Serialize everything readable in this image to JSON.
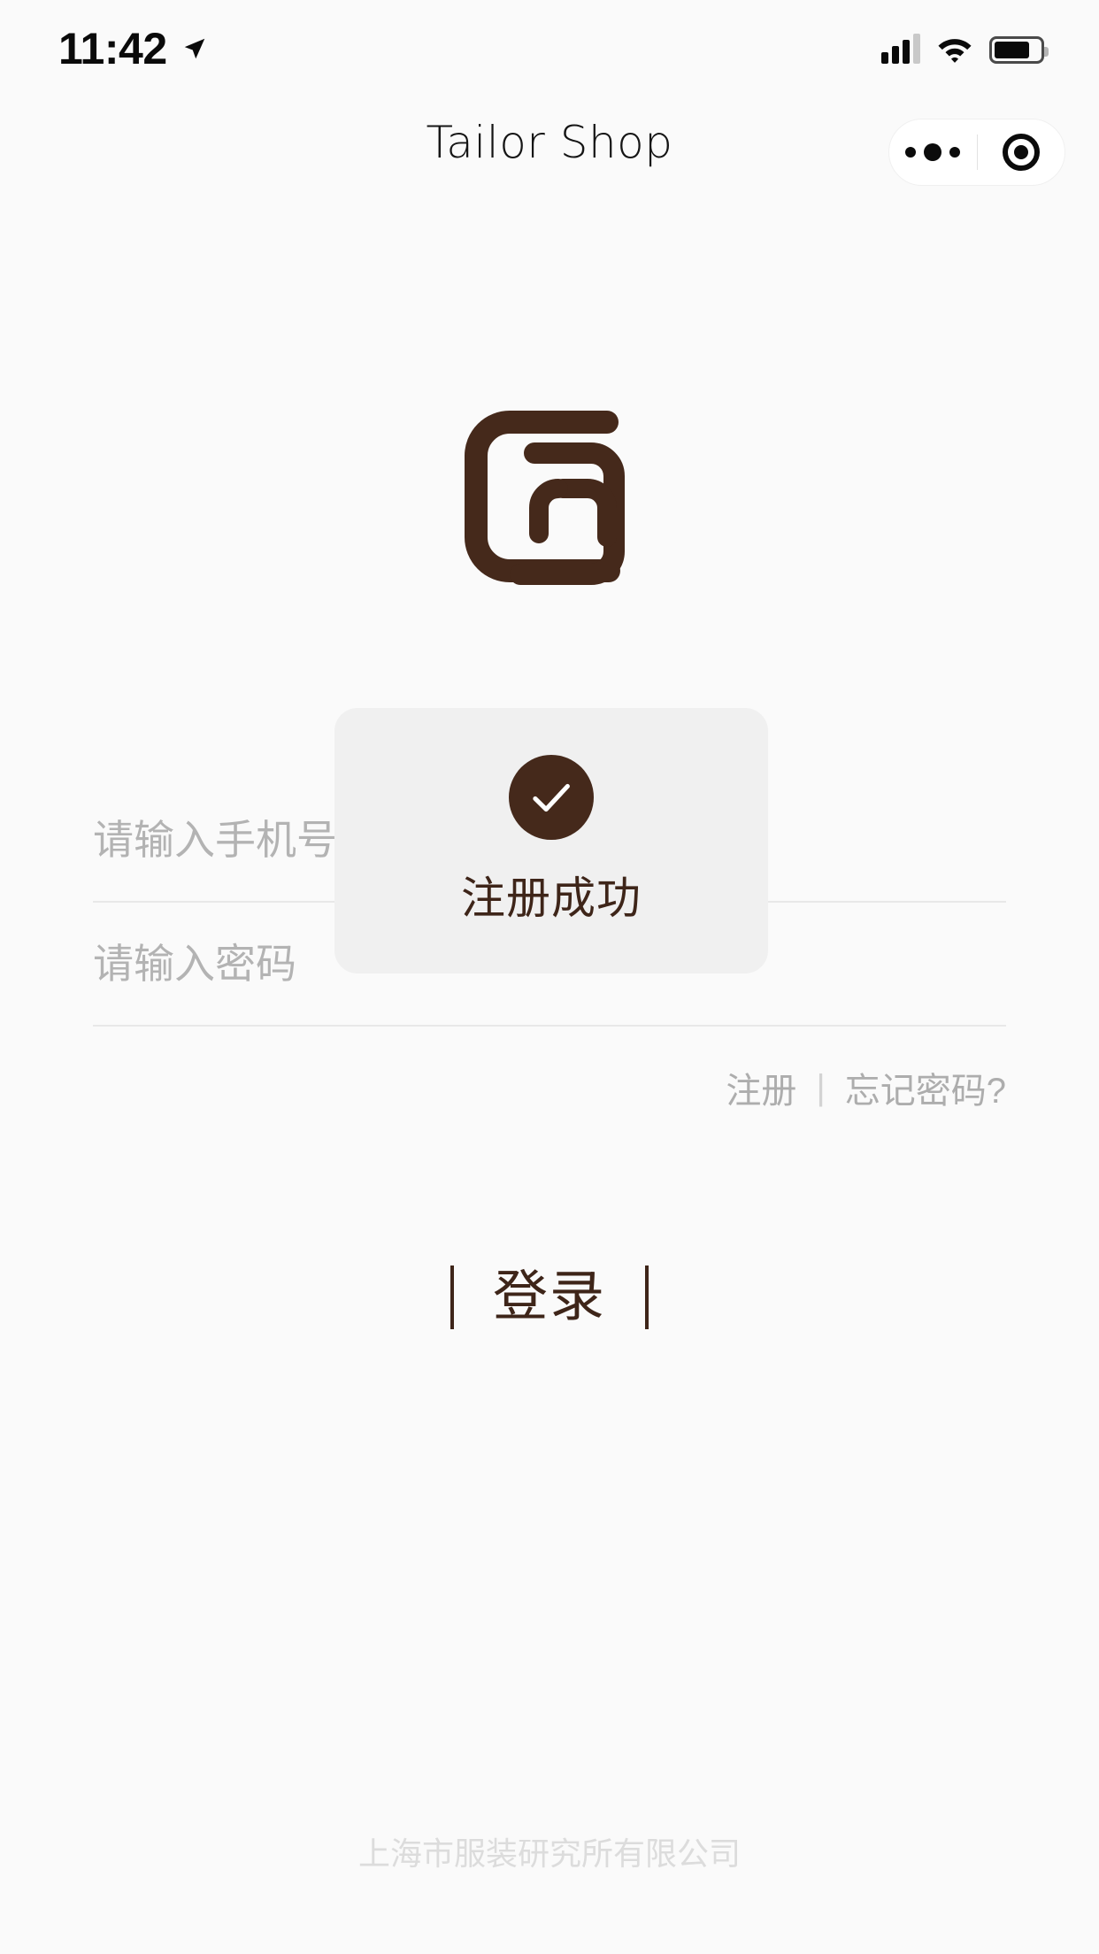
{
  "status_bar": {
    "time": "11:42",
    "location_icon": "location-arrow-icon",
    "signal_icon": "cellular-signal-icon",
    "wifi_icon": "wifi-icon",
    "battery_icon": "battery-icon"
  },
  "nav": {
    "title": "Tailor Shop",
    "more_icon": "more-dots-icon",
    "target_icon": "target-circle-icon"
  },
  "brand": {
    "logo_icon": "tailor-shop-logo-icon",
    "color": "#45291b"
  },
  "form": {
    "phone": {
      "placeholder": "请输入手机号",
      "value": ""
    },
    "password": {
      "placeholder": "请输入密码",
      "value": ""
    },
    "register_label": "注册",
    "separator": "|",
    "forgot_label": "忘记密码?"
  },
  "login": {
    "label": "登录",
    "left_bar": "",
    "right_bar": ""
  },
  "toast": {
    "message": "注册成功",
    "icon": "check-circle-icon",
    "icon_color": "#45291b",
    "background": "#f0f0f0"
  },
  "footer": {
    "company": "上海市服装研究所有限公司"
  },
  "colors": {
    "background": "#fafafa",
    "accent": "#3e2519",
    "placeholder": "#b3b3b3",
    "muted": "#adadad"
  }
}
